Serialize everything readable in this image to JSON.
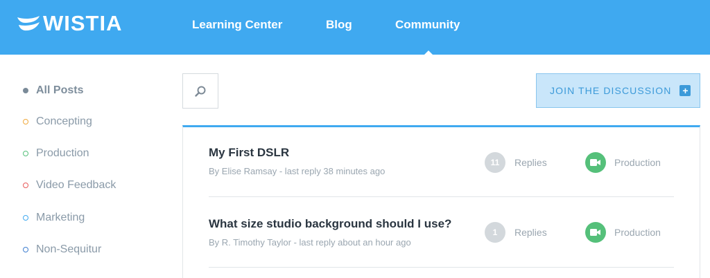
{
  "brand": {
    "name": "WISTIA"
  },
  "nav": {
    "items": [
      {
        "label": "Learning Center"
      },
      {
        "label": "Blog"
      },
      {
        "label": "Community"
      }
    ],
    "active": "Community"
  },
  "sidebar": {
    "categories": [
      {
        "label": "All Posts",
        "color": "#7a8a98",
        "active": true
      },
      {
        "label": "Concepting",
        "color": "#f0a93c"
      },
      {
        "label": "Production",
        "color": "#55c07a"
      },
      {
        "label": "Video Feedback",
        "color": "#e85a5a"
      },
      {
        "label": "Marketing",
        "color": "#3fa9f0"
      },
      {
        "label": "Non-Sequitur",
        "color": "#3f7fd0"
      }
    ]
  },
  "search": {
    "icon": "search-icon"
  },
  "join": {
    "label": "JOIN THE DISCUSSION",
    "icon": "+"
  },
  "posts": [
    {
      "title": "My First DSLR",
      "meta": "By Elise Ramsay - last reply 38 minutes ago",
      "reply_count": "11",
      "reply_label": "Replies",
      "tag": "Production"
    },
    {
      "title": "What size studio background should I use?",
      "meta": "By R. Timothy Taylor - last reply about an hour ago",
      "reply_count": "1",
      "reply_label": "Replies",
      "tag": "Production"
    }
  ],
  "colors": {
    "header": "#3fa9f0",
    "accent": "#3c9ad9",
    "production": "#55c07a"
  }
}
